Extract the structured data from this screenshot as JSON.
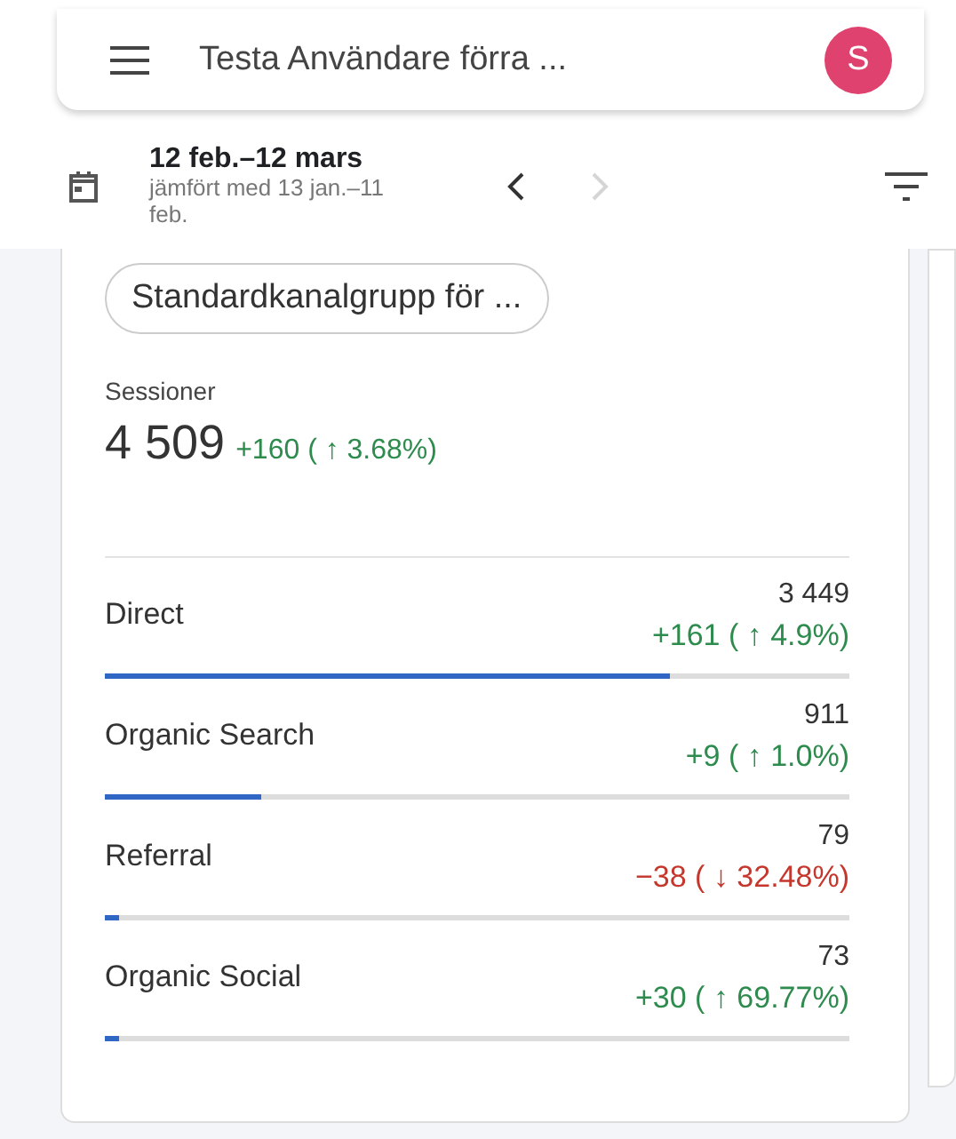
{
  "app_bar": {
    "title": "Testa Användare förra ...",
    "avatar": "S"
  },
  "date_bar": {
    "range": "12 feb.–12 mars",
    "comparison": "jämfört med 13 jan.–11 feb.",
    "next_disabled": true
  },
  "card": {
    "dimension_chip": "Standardkanalgrupp för ...",
    "metric": "Sessioner",
    "total": "4 509",
    "total_change": {
      "text": "+160 ( ↑ 3.68%)",
      "color": "#2e8b4e"
    },
    "rows": [
      {
        "name": "Direct",
        "value": "3 449",
        "change": "+161 ( ↑ 4.9%)",
        "color": "#2e8b4e",
        "level": 0.76
      },
      {
        "name": "Organic Search",
        "value": "911",
        "change": "+9 ( ↑ 1.0%)",
        "color": "#2e8b4e",
        "level": 0.21
      },
      {
        "name": "Referral",
        "value": "79",
        "change": "−38 ( ↓ 32.48%)",
        "color": "#c5372c",
        "level": 0.02
      },
      {
        "name": "Organic Social",
        "value": "73",
        "change": "+30 ( ↑ 69.77%)",
        "color": "#2e8b4e",
        "level": 0.02
      }
    ]
  }
}
